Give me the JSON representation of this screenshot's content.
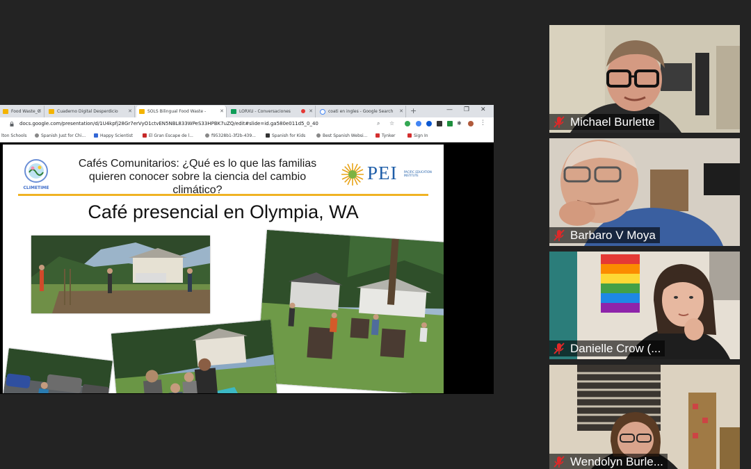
{
  "browser": {
    "tabs": [
      {
        "label": "Food Waste_C",
        "color": "#f4b400"
      },
      {
        "label": "Cuaderno Digital Desperdicio",
        "color": "#f4b400"
      },
      {
        "label": "SOLS Bilingual Food Waste -",
        "color": "#f4b400",
        "active": true
      },
      {
        "label": "LORXU - Conversaciones",
        "color": "#0f9d58"
      },
      {
        "label": "coati en ingles - Google Search",
        "color": "#4285f4"
      }
    ],
    "url": "docs.google.com/presentation/d/1U4kpfj28Gr7erVyO1ctvEN5NBL833WPeS33HPBK7uZQ/edit#slide=id.ga580e011d5_0_40",
    "bookmarks": [
      "lton Schools",
      "Spanish Just for Chi...",
      "Happy Scientist",
      "El Gran Escape de l...",
      "f95328b1-3f2b-439...",
      "Spanish for Kids",
      "Best Spanish Websi...",
      "Tynker",
      "Sign In"
    ]
  },
  "slide": {
    "title": "Cafés Comunitarios: ¿Qué es lo que las familias quieren conocer sobre la ciencia del cambio climático?",
    "heading": "Café presencial en Olympia, WA",
    "logo_left": "CLIMETIME",
    "logo_right": "PEI",
    "logo_right_sub": "PACIFIC EDUCATION INSTITUTE",
    "accent_color": "#f0b323",
    "pei_color": "#1f5ea8"
  },
  "participants": [
    {
      "name": "Michael Burlette",
      "muted": true
    },
    {
      "name": "Barbaro V Moya",
      "muted": true
    },
    {
      "name": "Danielle Crow (...",
      "muted": true
    },
    {
      "name": "Wendolyn Burle...",
      "muted": true
    }
  ],
  "colors": {
    "background": "#232323",
    "muted_icon": "#e02828"
  }
}
